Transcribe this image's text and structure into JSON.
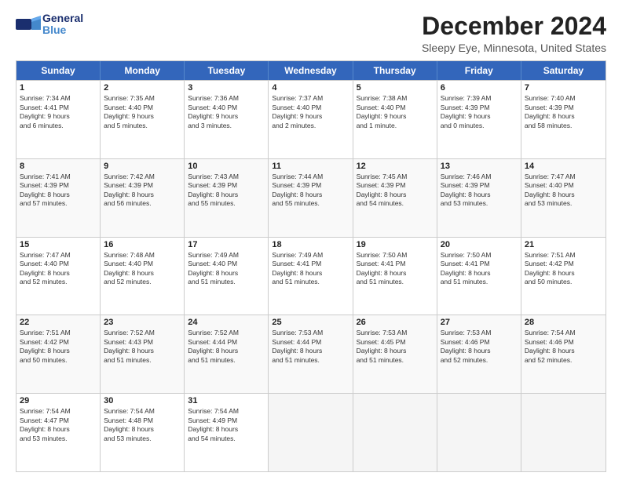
{
  "header": {
    "logo_line1": "General",
    "logo_line2": "Blue",
    "month_title": "December 2024",
    "location": "Sleepy Eye, Minnesota, United States"
  },
  "weekdays": [
    "Sunday",
    "Monday",
    "Tuesday",
    "Wednesday",
    "Thursday",
    "Friday",
    "Saturday"
  ],
  "weeks": [
    [
      {
        "day": "1",
        "text": "Sunrise: 7:34 AM\nSunset: 4:41 PM\nDaylight: 9 hours\nand 6 minutes."
      },
      {
        "day": "2",
        "text": "Sunrise: 7:35 AM\nSunset: 4:40 PM\nDaylight: 9 hours\nand 5 minutes."
      },
      {
        "day": "3",
        "text": "Sunrise: 7:36 AM\nSunset: 4:40 PM\nDaylight: 9 hours\nand 3 minutes."
      },
      {
        "day": "4",
        "text": "Sunrise: 7:37 AM\nSunset: 4:40 PM\nDaylight: 9 hours\nand 2 minutes."
      },
      {
        "day": "5",
        "text": "Sunrise: 7:38 AM\nSunset: 4:40 PM\nDaylight: 9 hours\nand 1 minute."
      },
      {
        "day": "6",
        "text": "Sunrise: 7:39 AM\nSunset: 4:39 PM\nDaylight: 9 hours\nand 0 minutes."
      },
      {
        "day": "7",
        "text": "Sunrise: 7:40 AM\nSunset: 4:39 PM\nDaylight: 8 hours\nand 58 minutes."
      }
    ],
    [
      {
        "day": "8",
        "text": "Sunrise: 7:41 AM\nSunset: 4:39 PM\nDaylight: 8 hours\nand 57 minutes."
      },
      {
        "day": "9",
        "text": "Sunrise: 7:42 AM\nSunset: 4:39 PM\nDaylight: 8 hours\nand 56 minutes."
      },
      {
        "day": "10",
        "text": "Sunrise: 7:43 AM\nSunset: 4:39 PM\nDaylight: 8 hours\nand 55 minutes."
      },
      {
        "day": "11",
        "text": "Sunrise: 7:44 AM\nSunset: 4:39 PM\nDaylight: 8 hours\nand 55 minutes."
      },
      {
        "day": "12",
        "text": "Sunrise: 7:45 AM\nSunset: 4:39 PM\nDaylight: 8 hours\nand 54 minutes."
      },
      {
        "day": "13",
        "text": "Sunrise: 7:46 AM\nSunset: 4:39 PM\nDaylight: 8 hours\nand 53 minutes."
      },
      {
        "day": "14",
        "text": "Sunrise: 7:47 AM\nSunset: 4:40 PM\nDaylight: 8 hours\nand 53 minutes."
      }
    ],
    [
      {
        "day": "15",
        "text": "Sunrise: 7:47 AM\nSunset: 4:40 PM\nDaylight: 8 hours\nand 52 minutes."
      },
      {
        "day": "16",
        "text": "Sunrise: 7:48 AM\nSunset: 4:40 PM\nDaylight: 8 hours\nand 52 minutes."
      },
      {
        "day": "17",
        "text": "Sunrise: 7:49 AM\nSunset: 4:40 PM\nDaylight: 8 hours\nand 51 minutes."
      },
      {
        "day": "18",
        "text": "Sunrise: 7:49 AM\nSunset: 4:41 PM\nDaylight: 8 hours\nand 51 minutes."
      },
      {
        "day": "19",
        "text": "Sunrise: 7:50 AM\nSunset: 4:41 PM\nDaylight: 8 hours\nand 51 minutes."
      },
      {
        "day": "20",
        "text": "Sunrise: 7:50 AM\nSunset: 4:41 PM\nDaylight: 8 hours\nand 51 minutes."
      },
      {
        "day": "21",
        "text": "Sunrise: 7:51 AM\nSunset: 4:42 PM\nDaylight: 8 hours\nand 50 minutes."
      }
    ],
    [
      {
        "day": "22",
        "text": "Sunrise: 7:51 AM\nSunset: 4:42 PM\nDaylight: 8 hours\nand 50 minutes."
      },
      {
        "day": "23",
        "text": "Sunrise: 7:52 AM\nSunset: 4:43 PM\nDaylight: 8 hours\nand 51 minutes."
      },
      {
        "day": "24",
        "text": "Sunrise: 7:52 AM\nSunset: 4:44 PM\nDaylight: 8 hours\nand 51 minutes."
      },
      {
        "day": "25",
        "text": "Sunrise: 7:53 AM\nSunset: 4:44 PM\nDaylight: 8 hours\nand 51 minutes."
      },
      {
        "day": "26",
        "text": "Sunrise: 7:53 AM\nSunset: 4:45 PM\nDaylight: 8 hours\nand 51 minutes."
      },
      {
        "day": "27",
        "text": "Sunrise: 7:53 AM\nSunset: 4:46 PM\nDaylight: 8 hours\nand 52 minutes."
      },
      {
        "day": "28",
        "text": "Sunrise: 7:54 AM\nSunset: 4:46 PM\nDaylight: 8 hours\nand 52 minutes."
      }
    ],
    [
      {
        "day": "29",
        "text": "Sunrise: 7:54 AM\nSunset: 4:47 PM\nDaylight: 8 hours\nand 53 minutes."
      },
      {
        "day": "30",
        "text": "Sunrise: 7:54 AM\nSunset: 4:48 PM\nDaylight: 8 hours\nand 53 minutes."
      },
      {
        "day": "31",
        "text": "Sunrise: 7:54 AM\nSunset: 4:49 PM\nDaylight: 8 hours\nand 54 minutes."
      },
      {
        "day": "",
        "text": ""
      },
      {
        "day": "",
        "text": ""
      },
      {
        "day": "",
        "text": ""
      },
      {
        "day": "",
        "text": ""
      }
    ]
  ]
}
